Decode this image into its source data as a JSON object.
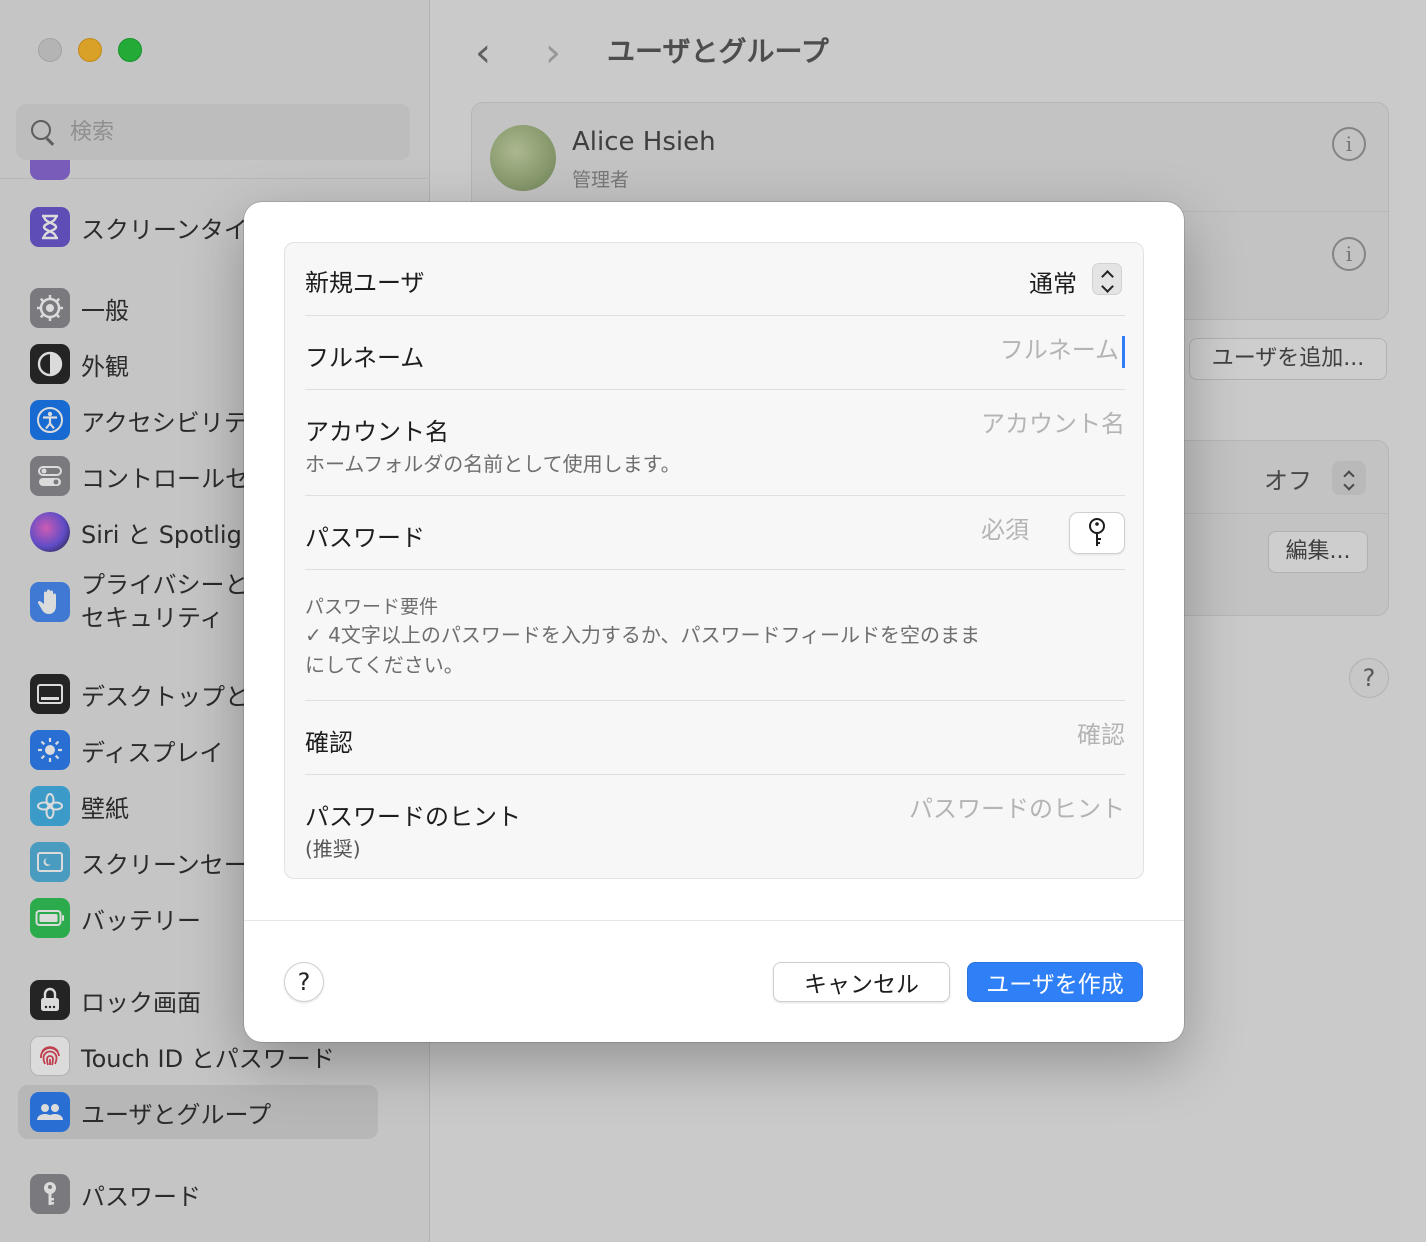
{
  "window": {
    "traffic_lights": [
      "close",
      "minimize",
      "maximize"
    ]
  },
  "sidebar": {
    "search": {
      "placeholder": "検索"
    },
    "items": [
      {
        "label": "スクリーンタイ",
        "icon": "hourglass-icon",
        "color": "#6e5ad3"
      },
      {
        "label": "一般",
        "icon": "gear-icon",
        "color": "#8e8e93"
      },
      {
        "label": "外観",
        "icon": "appearance-icon",
        "color": "#1d1d1f"
      },
      {
        "label": "アクセシビリテ",
        "icon": "accessibility-icon",
        "color": "#1a7cf5"
      },
      {
        "label": "コントロールセ",
        "icon": "control-center-icon",
        "color": "#8e8e93"
      },
      {
        "label": "Siri と Spotligh",
        "icon": "siri-icon",
        "color": "#b347e0"
      },
      {
        "label": "プライバシーと",
        "label2": "セキュリティ",
        "icon": "hand-icon",
        "color": "#3b82f6"
      },
      {
        "label": "デスクトップと",
        "icon": "desktop-icon",
        "color": "#1d1d1f"
      },
      {
        "label": "ディスプレイ",
        "icon": "display-icon",
        "color": "#2f80f6"
      },
      {
        "label": "壁紙",
        "icon": "wallpaper-icon",
        "color": "#45b4e8"
      },
      {
        "label": "スクリーンセー",
        "icon": "screensaver-icon",
        "color": "#55b5e0"
      },
      {
        "label": "バッテリー",
        "icon": "battery-icon",
        "color": "#34c759"
      },
      {
        "label": "ロック画面",
        "icon": "lock-icon",
        "color": "#1d1d1f"
      },
      {
        "label": "Touch ID とパスワード",
        "icon": "fingerprint-icon",
        "color": "#ffffff"
      },
      {
        "label": "ユーザとグループ",
        "icon": "users-icon",
        "color": "#2f80f6",
        "selected": true
      },
      {
        "label": "パスワード",
        "icon": "key-icon",
        "color": "#8e8e93"
      }
    ]
  },
  "main": {
    "title": "ユーザとグループ",
    "user": {
      "name": "Alice Hsieh",
      "role": "管理者"
    },
    "add_user_button": "ユーザを追加...",
    "auto_login_value": "オフ",
    "edit_button": "編集...",
    "help": "?"
  },
  "dialog": {
    "new_user_label": "新規ユーザ",
    "account_type_value": "通常",
    "full_name": {
      "label": "フルネーム",
      "placeholder": "フルネーム",
      "value": ""
    },
    "account_name": {
      "label": "アカウント名",
      "sublabel": "ホームフォルダの名前として使用します。",
      "placeholder": "アカウント名",
      "value": ""
    },
    "password": {
      "label": "パスワード",
      "placeholder": "必須",
      "value": ""
    },
    "requirements": {
      "title": "パスワード要件",
      "line1": "✓ 4文字以上のパスワードを入力するか、パスワードフィールドを空のまま",
      "line2": "にしてください。"
    },
    "verify": {
      "label": "確認",
      "placeholder": "確認",
      "value": ""
    },
    "hint": {
      "label": "パスワードのヒント",
      "sublabel": "(推奨)",
      "placeholder": "パスワードのヒント",
      "value": ""
    },
    "help_label": "?",
    "cancel_label": "キャンセル",
    "create_label": "ユーザを作成"
  },
  "colors": {
    "accent": "#2f80f6",
    "caret": "#2f7cf6"
  }
}
